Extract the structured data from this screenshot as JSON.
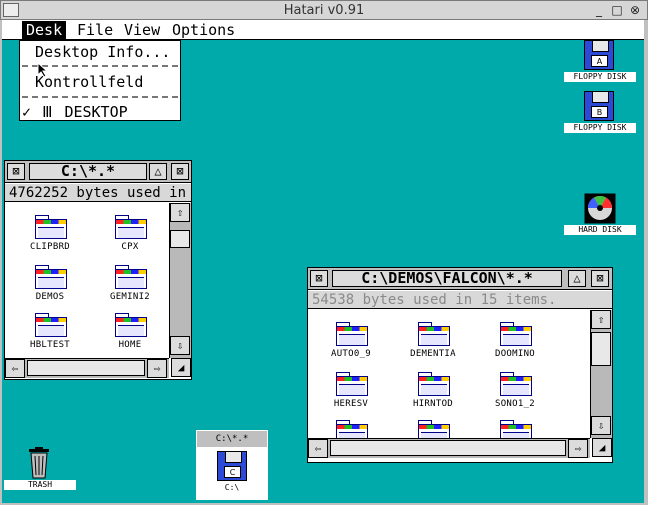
{
  "app": {
    "title": "Hatari v0.91",
    "left_button": "",
    "minimize": "_",
    "maximize": "□",
    "close": "⊗"
  },
  "menubar": {
    "items": [
      "Desk",
      "File",
      "View",
      "Options"
    ]
  },
  "desk_menu": {
    "items": [
      "Desktop Info...",
      "Kontrollfeld",
      "DESKTOP"
    ],
    "checkmark": "✓",
    "atari_logo": "Ⅲ"
  },
  "window_c": {
    "close_glyph": "⊠",
    "full_glyph": "⊠",
    "up_glyph": "△",
    "title": "C:\\*.*",
    "info": "4762252 bytes used in",
    "folders": [
      "CLIPBRD",
      "CPX",
      "DEMOS",
      "GEMINI2",
      "HBLTEST",
      "HOME"
    ],
    "scroll_up": "⇧",
    "scroll_down": "⇩",
    "scroll_left": "⇦",
    "scroll_right": "⇨",
    "resize": "◢"
  },
  "window_falcon": {
    "close_glyph": "⊠",
    "full_glyph": "⊠",
    "up_glyph": "△",
    "title": "C:\\DEMOS\\FALCON\\*.*",
    "info": "54538 bytes used in 15 items.",
    "folders": [
      "AUTO0_9",
      "DEMENTIA",
      "DOOMINO",
      "HERESV",
      "HIRNTOD",
      "SONO1_2",
      "",
      "",
      ""
    ],
    "scroll_up": "⇧",
    "scroll_down": "⇩",
    "scroll_left": "⇦",
    "scroll_right": "⇨",
    "resize": "◢"
  },
  "mini_window": {
    "title": "C:\\*.*",
    "drive_letter": "C",
    "label": "C:\\"
  },
  "desktop_icons": {
    "floppy_a": {
      "letter": "A",
      "label": "FLOPPY DISK"
    },
    "floppy_b": {
      "letter": "B",
      "label": "FLOPPY DISK"
    },
    "hard_disk": {
      "label": "HARD DISK"
    },
    "trash": {
      "label": "TRASH"
    }
  },
  "colors": {
    "desktop": "#00aaaa",
    "floppy_blue": "#2d4ad6",
    "folder_outline": "#00008a"
  }
}
